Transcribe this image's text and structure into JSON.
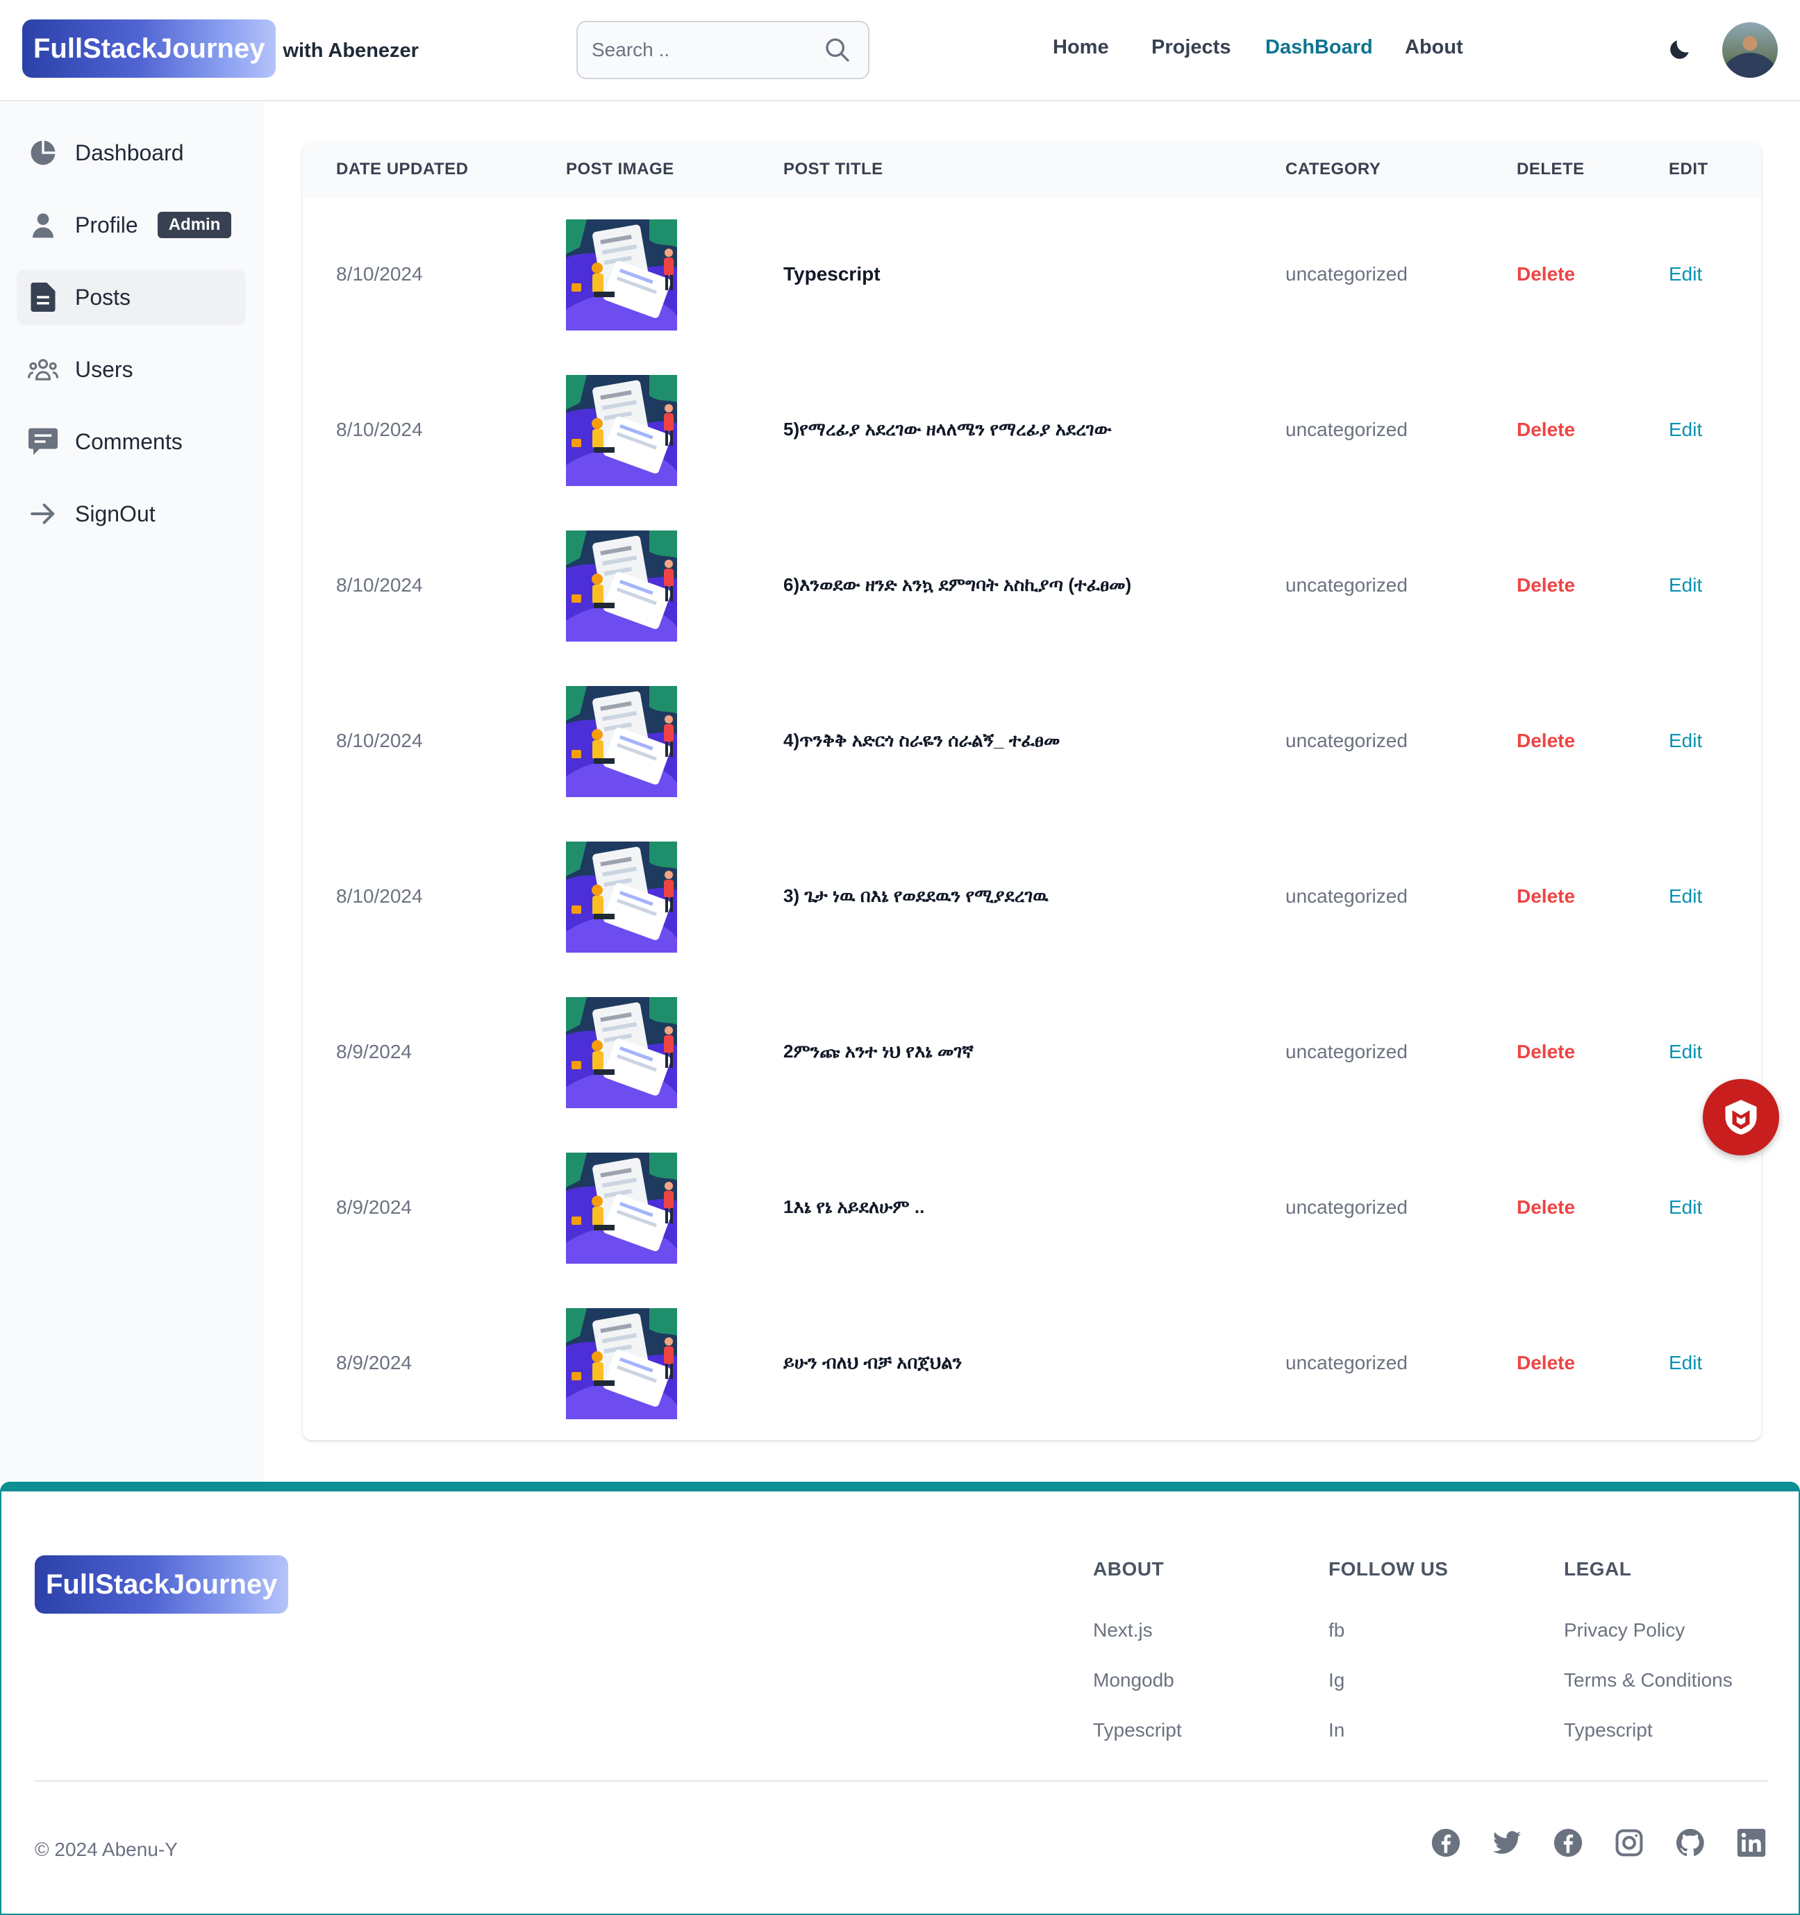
{
  "header": {
    "brand": "FullStackJourney",
    "brand_suffix": "with Abenezer",
    "search_placeholder": "Search ..",
    "nav": [
      {
        "label": "Home"
      },
      {
        "label": "Projects"
      },
      {
        "label": "DashBoard",
        "active": true
      },
      {
        "label": "About"
      }
    ],
    "theme_icon": "moon-icon",
    "avatar_icon": "user-avatar"
  },
  "sidebar": {
    "items": [
      {
        "label": "Dashboard",
        "icon": "pie-chart-icon"
      },
      {
        "label": "Profile",
        "icon": "user-icon",
        "badge": "Admin"
      },
      {
        "label": "Posts",
        "icon": "document-icon",
        "active": true
      },
      {
        "label": "Users",
        "icon": "users-group-icon"
      },
      {
        "label": "Comments",
        "icon": "comment-icon"
      },
      {
        "label": "SignOut",
        "icon": "arrow-right-icon"
      }
    ]
  },
  "table": {
    "headers": [
      "DATE UPDATED",
      "POST IMAGE",
      "POST TITLE",
      "CATEGORY",
      "DELETE",
      "EDIT"
    ],
    "rows": [
      {
        "date": "8/10/2024",
        "title": "Typescript",
        "category": "uncategorized",
        "delete": "Delete",
        "edit": "Edit"
      },
      {
        "date": "8/10/2024",
        "title": "5)የማረፊያ አደረገው ዘላለሜን የማረፊያ አደረገው",
        "category": "uncategorized",
        "delete": "Delete",
        "edit": "Edit"
      },
      {
        "date": "8/10/2024",
        "title": "6)እንወደው ዘንድ አንኳ ደምግባት አስኪያጣ (ተፈፀመ)",
        "category": "uncategorized",
        "delete": "Delete",
        "edit": "Edit"
      },
      {
        "date": "8/10/2024",
        "title": "4)ጥንቅቅ አድርጎ ስራዬን ሰራልኝ_ ተፈፀመ",
        "category": "uncategorized",
        "delete": "Delete",
        "edit": "Edit"
      },
      {
        "date": "8/10/2024",
        "title": "3) ጌታ ነዉ በእኔ የወደደዉን የሚያደረገዉ",
        "category": "uncategorized",
        "delete": "Delete",
        "edit": "Edit"
      },
      {
        "date": "8/9/2024",
        "title": "2ምንጩ አንተ ነህ የእኔ መገኛ",
        "category": "uncategorized",
        "delete": "Delete",
        "edit": "Edit"
      },
      {
        "date": "8/9/2024",
        "title": "1እኔ የኔ አይደለሁም ..",
        "category": "uncategorized",
        "delete": "Delete",
        "edit": "Edit"
      },
      {
        "date": "8/9/2024",
        "title": "ይሁን ብለህ ብቻ አበጀህልን",
        "category": "uncategorized",
        "delete": "Delete",
        "edit": "Edit"
      }
    ]
  },
  "floating_button": {
    "icon": "shield-m-icon",
    "color": "#c81e1e"
  },
  "footer": {
    "brand": "FullStackJourney",
    "columns": [
      {
        "title": "ABOUT",
        "links": [
          "Next.js",
          "Mongodb",
          "Typescript"
        ]
      },
      {
        "title": "FOLLOW US",
        "links": [
          "fb",
          "Ig",
          "In"
        ]
      },
      {
        "title": "LEGAL",
        "links": [
          "Privacy Policy",
          "Terms & Conditions",
          "Typescript"
        ]
      }
    ],
    "copyright": "© 2024 Abenu-Y",
    "social_icons": [
      "facebook-icon",
      "twitter-icon",
      "facebook-icon",
      "instagram-icon",
      "github-icon",
      "linkedin-icon"
    ]
  },
  "colors": {
    "accent": "#0e7490",
    "delete": "#ef4444",
    "edit": "#0891b2",
    "footer_border": "#0e8f94"
  }
}
